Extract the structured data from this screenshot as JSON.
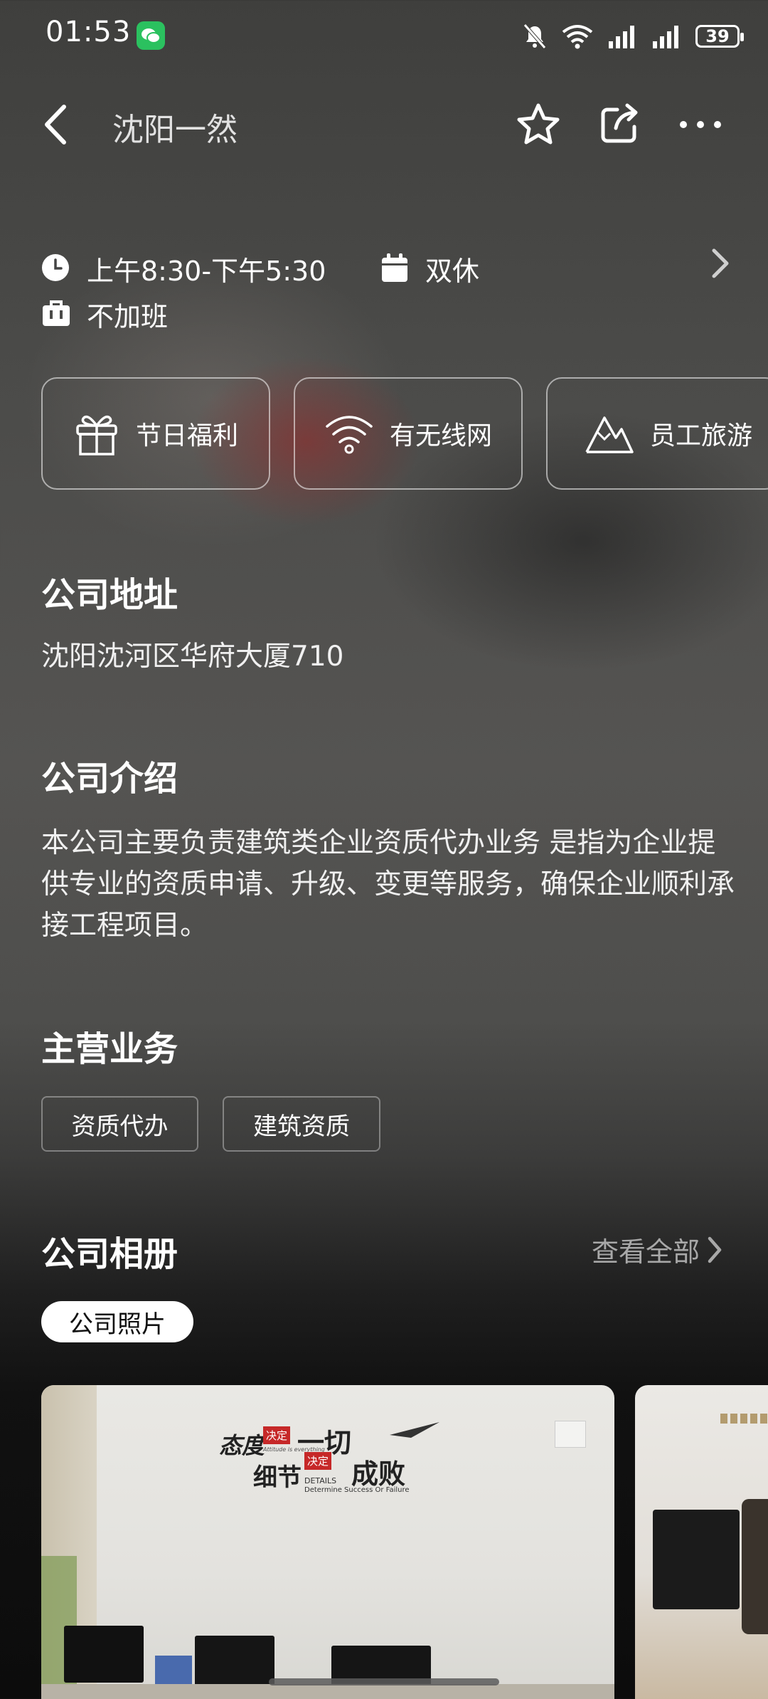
{
  "status_bar": {
    "time": "01:53",
    "battery": "39"
  },
  "header": {
    "title": "沈阳一然"
  },
  "info": {
    "work_hours": "上午8:30-下午5:30",
    "rest": "双休",
    "overtime": "不加班"
  },
  "benefits": [
    {
      "label": "节日福利",
      "icon": "gift-icon"
    },
    {
      "label": "有无线网",
      "icon": "wifi-icon"
    },
    {
      "label": "员工旅游",
      "icon": "mountain-icon"
    }
  ],
  "address": {
    "title": "公司地址",
    "text": "沈阳沈河区华府大厦710"
  },
  "intro": {
    "title": "公司介绍",
    "text": "本公司主要负责建筑类企业资质代办业务 是指为企业提供专业的资质申请、升级、变更等服务，确保企业顺利承接工程项目。"
  },
  "business": {
    "title": "主营业务",
    "tags": [
      "资质代办",
      "建筑资质"
    ]
  },
  "album": {
    "title": "公司相册",
    "view_all": "查看全部",
    "tab": "公司照片",
    "photo_text": {
      "line1a": "态度",
      "badge1": "决定",
      "line1b": "一切",
      "small": "Attitude is everything",
      "line2a": "细节",
      "badge2": "决定",
      "line2b": "成败",
      "details": "DETAILS",
      "sub": "Determine Success Or Failure"
    }
  }
}
